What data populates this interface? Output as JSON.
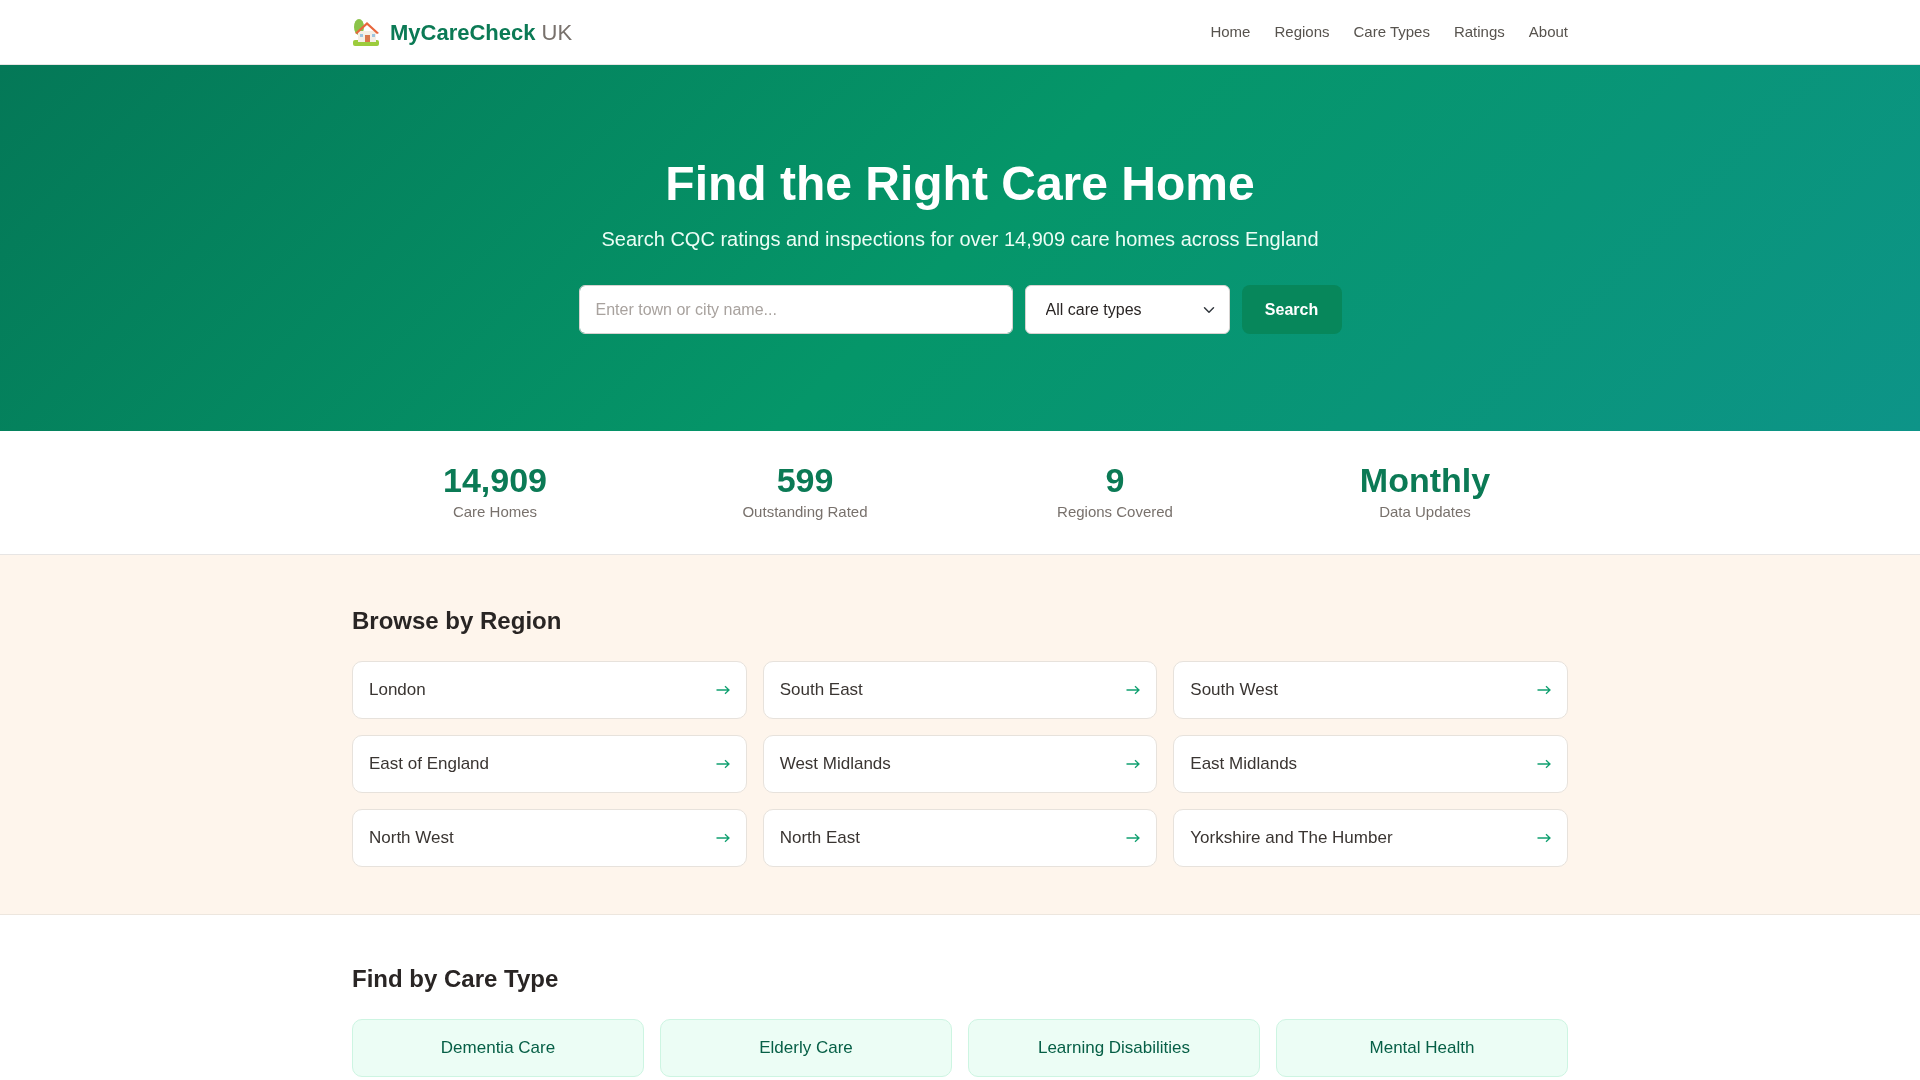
{
  "navbar": {
    "brand": "MyCareCheck",
    "brand_suffix": "UK",
    "links": [
      "Home",
      "Regions",
      "Care Types",
      "Ratings",
      "About"
    ]
  },
  "hero": {
    "title": "Find the Right Care Home",
    "subtitle": "Search CQC ratings and inspections for over 14,909 care homes across England",
    "search": {
      "placeholder": "Enter town or city name...",
      "care_type_select": "All care types",
      "button": "Search"
    }
  },
  "stats": [
    {
      "value": "14,909",
      "label": "Care Homes"
    },
    {
      "value": "599",
      "label": "Outstanding Rated"
    },
    {
      "value": "9",
      "label": "Regions Covered"
    },
    {
      "value": "Monthly",
      "label": "Data Updates"
    }
  ],
  "regions": {
    "heading": "Browse by Region",
    "items": [
      "London",
      "South East",
      "South West",
      "East of England",
      "West Midlands",
      "East Midlands",
      "North West",
      "North East",
      "Yorkshire and The Humber"
    ]
  },
  "care_types": {
    "heading": "Find by Care Type",
    "items": [
      "Dementia Care",
      "Elderly Care",
      "Learning Disabilities",
      "Mental Health"
    ]
  }
}
